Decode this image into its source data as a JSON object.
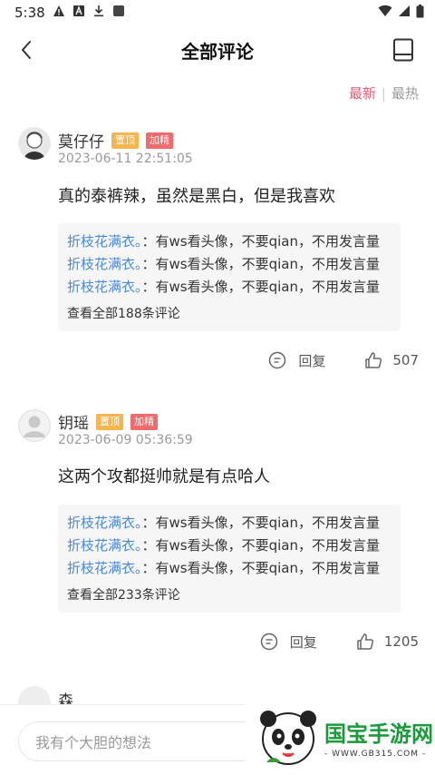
{
  "status_bar": {
    "time": "5:38"
  },
  "header": {
    "title": "全部评论"
  },
  "sort": {
    "newest": "最新",
    "separator": "|",
    "hottest": "最热"
  },
  "comments": [
    {
      "username": "莫仔仔",
      "badge_top": "置顶",
      "badge_featured": "加精",
      "time": "2023-06-11 22:51:05",
      "text": "真的泰裤辣，虽然是黑白，但是我喜欢",
      "replies": [
        {
          "name": "折枝花满衣。",
          "text": "：有ws看头像，不要qian，不用发言量"
        },
        {
          "name": "折枝花满衣。",
          "text": "：有ws看头像，不要qian，不用发言量"
        },
        {
          "name": "折枝花满衣。",
          "text": "：有ws看头像，不要qian，不用发言量"
        }
      ],
      "view_all": "查看全部188条评论",
      "reply_label": "回复",
      "likes": "507"
    },
    {
      "username": "钥瑶",
      "badge_top": "置顶",
      "badge_featured": "加精",
      "time": "2023-06-09 05:36:59",
      "text": "这两个攻都挺帅就是有点哈人",
      "replies": [
        {
          "name": "折枝花满衣。",
          "text": "：有ws看头像，不要qian，不用发言量"
        },
        {
          "name": "折枝花满衣。",
          "text": "：有ws看头像，不要qian，不用发言量"
        },
        {
          "name": "折枝花满衣。",
          "text": "：有ws看头像，不要qian，不用发言量"
        }
      ],
      "view_all": "查看全部233条评论",
      "reply_label": "回复",
      "likes": "1205"
    }
  ],
  "partial_comment": {
    "username": "森"
  },
  "bottom": {
    "input_placeholder": "我有个大胆的想法"
  },
  "watermark": {
    "title": "国宝手游网",
    "url": "- WWW.GB315.COM -"
  },
  "colors": {
    "accent": "#e05b73",
    "reply_name": "#4a8ad6",
    "badge_top": "#f5b650",
    "badge_featured": "#ef6a6a"
  }
}
